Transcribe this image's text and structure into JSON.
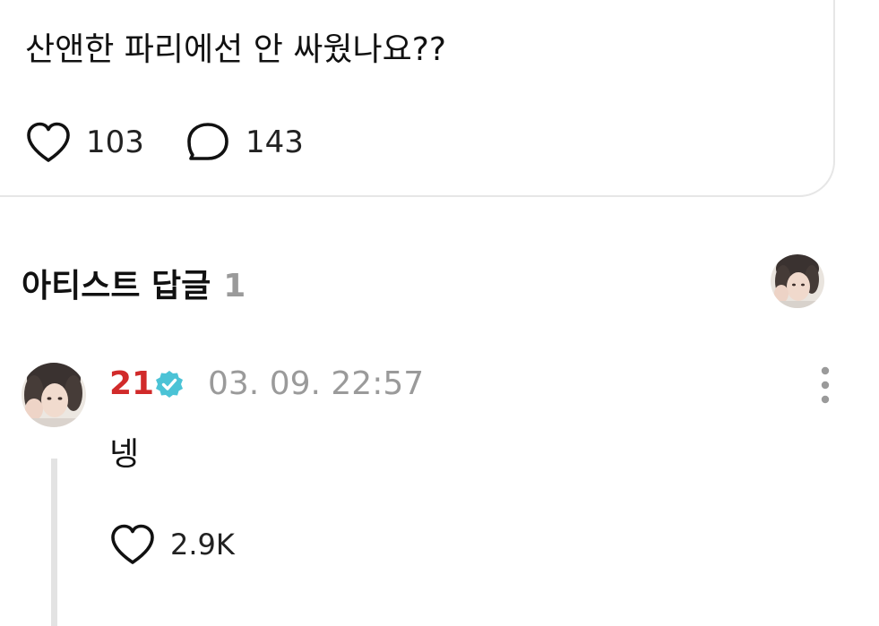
{
  "post": {
    "text": "산앤한 파리에선 안 싸웠나요??",
    "likes": "103",
    "comments": "143"
  },
  "section": {
    "title": "아티스트 답글",
    "count": "1"
  },
  "reply": {
    "author": "21",
    "timestamp": "03. 09. 22:57",
    "text": "넹",
    "likes": "2.9K"
  },
  "icons": {
    "like": "heart-icon",
    "comment": "speech-bubble-icon",
    "verified": "verified-badge-icon",
    "more": "more-vertical-icon"
  },
  "colors": {
    "author_name": "#d12a2a",
    "verified_badge": "#4bc3d6",
    "muted_text": "#9a9a9a"
  }
}
